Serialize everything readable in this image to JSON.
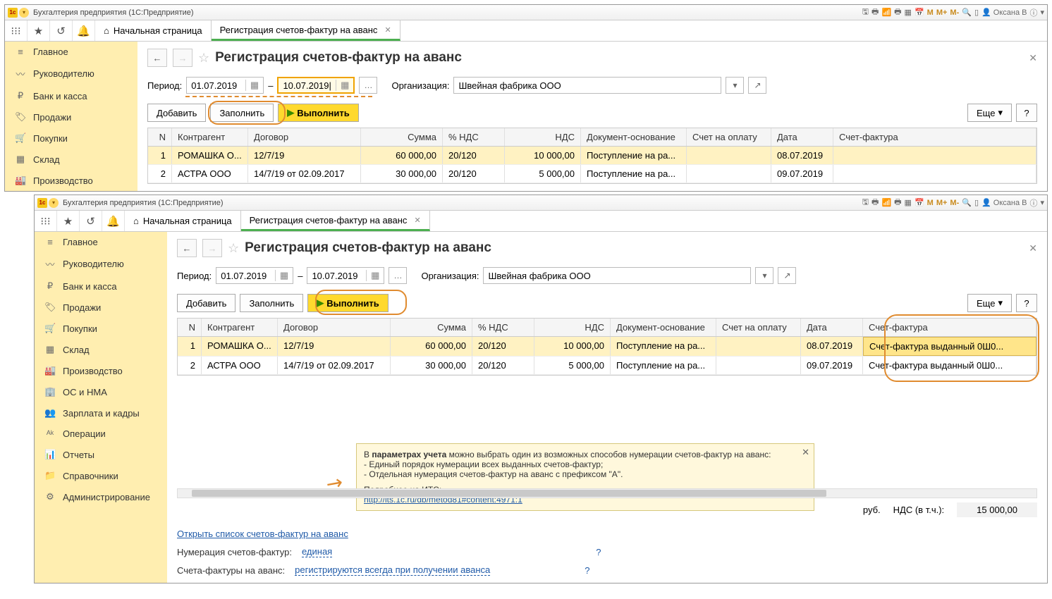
{
  "app": {
    "title": "Бухгалтерия предприятия   (1С:Предприятие)",
    "user": "Оксана В",
    "M": "M",
    "Mp": "M+",
    "Mm": "M-"
  },
  "tabs": {
    "home": "Начальная страница",
    "reg": "Регистрация счетов-фактур на аванс"
  },
  "sidebar": {
    "i0": "Главное",
    "i1": "Руководителю",
    "i2": "Банк и касса",
    "i3": "Продажи",
    "i4": "Покупки",
    "i5": "Склад",
    "i6": "Производство",
    "i7": "ОС и НМА",
    "i8": "Зарплата и кадры",
    "i9": "Операции",
    "i10": "Отчеты",
    "i11": "Справочники",
    "i12": "Администрирование"
  },
  "page": {
    "title": "Регистрация счетов-фактур на аванс",
    "period_lbl": "Период:",
    "from": "01.07.2019",
    "to": "10.07.2019",
    "to_caret": "10.07.2019|",
    "dash": "–",
    "org_lbl": "Организация:",
    "org": "Швейная фабрика ООО",
    "add": "Добавить",
    "fill": "Заполнить",
    "run": "Выполнить",
    "more": "Еще",
    "q": "?"
  },
  "cols": {
    "n": "N",
    "kontr": "Контрагент",
    "dog": "Договор",
    "sum": "Сумма",
    "ndsp": "% НДС",
    "nds": "НДС",
    "doc": "Документ-основание",
    "schet": "Счет на оплату",
    "date": "Дата",
    "sf": "Счет-фактура"
  },
  "rows": {
    "r1": {
      "n": "1",
      "kontr": "РОМАШКА О...",
      "dog": "12/7/19",
      "sum": "60 000,00",
      "ndsp": "20/120",
      "nds": "10 000,00",
      "doc": "Поступление на ра...",
      "date": "08.07.2019",
      "sf": "Счет-фактура выданный 0Ш0..."
    },
    "r2": {
      "n": "2",
      "kontr": "АСТРА ООО",
      "dog": "14/7/19 от 02.09.2017",
      "sum": "30 000,00",
      "ndsp": "20/120",
      "nds": "5 000,00",
      "doc": "Поступление на ра...",
      "date": "09.07.2019",
      "sf": "Счет-фактура выданный 0Ш0..."
    }
  },
  "footer": {
    "openlist": "Открыть список счетов-фактур на аванс",
    "num_lbl": "Нумерация счетов-фактур:",
    "num_val": "единая",
    "avans_lbl": "Счета-фактуры на аванс:",
    "avans_val": "регистрируются всегда при получении аванса",
    "rub": "руб.",
    "nds_lbl": "НДС (в т.ч.):",
    "nds_val": "15 000,00"
  },
  "tip": {
    "l1a": "В ",
    "l1b": "параметрах учета",
    "l1c": " можно выбрать один из возможных способов нумерации счетов-фактур на аванс:",
    "l2": "- Единый порядок нумерации всех выданных счетов-фактур;",
    "l3": "- Отдельная нумерация счетов-фактур на аванс с префиксом \"А\".",
    "l4": "Подробнее на ИТС:",
    "url": "http://its.1c.ru/db/metod81#content:4971:1"
  }
}
